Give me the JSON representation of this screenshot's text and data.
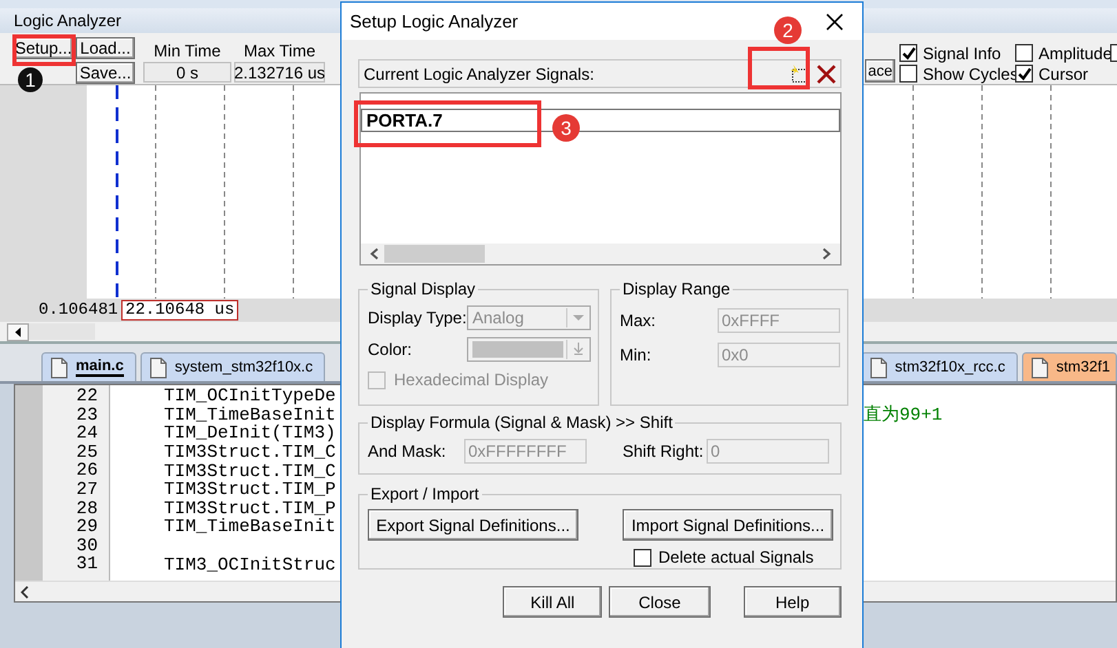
{
  "panel": {
    "title": "Logic Analyzer"
  },
  "toolbar": {
    "buttons": [
      "Setup...",
      "Load...",
      "Save..."
    ],
    "min_time": {
      "label": "Min Time",
      "value": "0 s"
    },
    "max_time": {
      "label": "Max Time",
      "value": "2.132716 us"
    },
    "partial_button": "ace",
    "options": [
      {
        "label": "Signal Info",
        "checked": true
      },
      {
        "label": "Amplitude",
        "checked": false
      },
      {
        "checked": false
      },
      {
        "label": "Show Cycles",
        "checked": false
      },
      {
        "label": "Cursor",
        "checked": true
      }
    ]
  },
  "waveform": {
    "time_left": "0.106481",
    "cursor_time": "22.10648 us"
  },
  "editor_tabs": [
    {
      "label": "main.c",
      "selected": true,
      "color": "#c9d9f1"
    },
    {
      "label": "system_stm32f10x.c",
      "selected": false,
      "color": "#c9d9f1"
    },
    {
      "label": "stm32f10x_rcc.c",
      "selected": false,
      "color": "#c9d9f1"
    },
    {
      "label": "stm32f1",
      "selected": false,
      "color": "#f8b888"
    }
  ],
  "code_lines": [
    {
      "number": "22",
      "code": "TIM_OCInitTypeDe"
    },
    {
      "number": "23",
      "code": "TIM_TimeBaseInit",
      "comment": "直为99+1"
    },
    {
      "number": "24",
      "code": "TIM_DeInit(TIM3)"
    },
    {
      "number": "25",
      "code": "TIM3Struct.TIM_C"
    },
    {
      "number": "26",
      "code": "TIM3Struct.TIM_C"
    },
    {
      "number": "27",
      "code": "TIM3Struct.TIM_P"
    },
    {
      "number": "28",
      "code": "TIM3Struct.TIM_P"
    },
    {
      "number": "29",
      "code": "TIM_TimeBaseInit"
    },
    {
      "number": "30"
    },
    {
      "number": "31",
      "code": "TIM3_OCInitStruc"
    }
  ],
  "dialog": {
    "title": "Setup Logic Analyzer",
    "signals_label": "Current Logic Analyzer Signals:",
    "signals": [
      "PORTA.7"
    ],
    "signal_display": {
      "title": "Signal Display",
      "display_type": {
        "label": "Display Type:",
        "value": "Analog",
        "disabled": true
      },
      "color": {
        "label": "Color:",
        "disabled": true
      },
      "hexadecimal": {
        "label": "Hexadecimal Display",
        "checked": false,
        "disabled": true
      }
    },
    "display_range": {
      "title": "Display Range",
      "max": {
        "label": "Max:",
        "value": "0xFFFF",
        "disabled": true
      },
      "min": {
        "label": "Min:",
        "value": "0x0",
        "disabled": true
      }
    },
    "formula": {
      "title": "Display Formula (Signal & Mask) >> Shift",
      "and_mask": {
        "label": "And Mask:",
        "value": "0xFFFFFFFF",
        "disabled": true
      },
      "shift_right": {
        "label": "Shift Right:",
        "value": "0",
        "disabled": true
      }
    },
    "export_import": {
      "title": "Export / Import",
      "export_button": "Export Signal Definitions...",
      "import_button": "Import Signal Definitions...",
      "delete_signals": {
        "label": "Delete actual Signals",
        "checked": false
      }
    },
    "buttons": [
      "Kill All",
      "Close",
      "Help"
    ]
  },
  "annotations": [
    {
      "number": "1",
      "kind": "dark"
    },
    {
      "number": "2",
      "kind": "red"
    },
    {
      "number": "3",
      "kind": "red"
    }
  ]
}
